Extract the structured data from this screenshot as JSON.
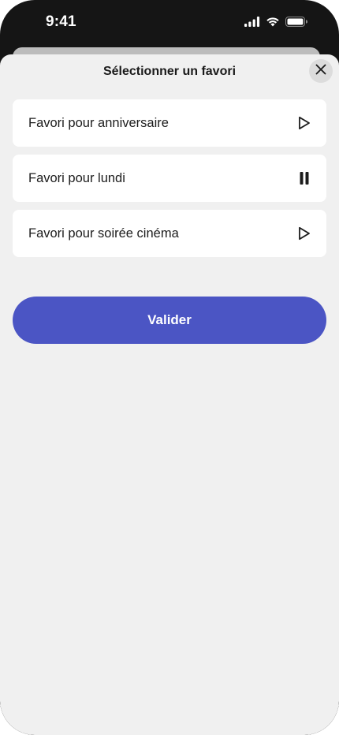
{
  "status_bar": {
    "time": "9:41",
    "icons": [
      "cellular-signal-icon",
      "wifi-icon",
      "battery-icon"
    ]
  },
  "sheet": {
    "title": "Sélectionner un favori",
    "close_icon": "close-icon"
  },
  "favorites": [
    {
      "label": "Favori pour anniversaire",
      "icon": "play-icon"
    },
    {
      "label": "Favori pour lundi",
      "icon": "pause-icon"
    },
    {
      "label": "Favori pour soirée cinéma",
      "icon": "play-icon"
    }
  ],
  "validate_button": {
    "label": "Valider"
  },
  "colors": {
    "accent": "#4b55c4",
    "sheet_background": "#f0f0f0",
    "card_background": "#ffffff",
    "status_bar_background": "#151515"
  }
}
